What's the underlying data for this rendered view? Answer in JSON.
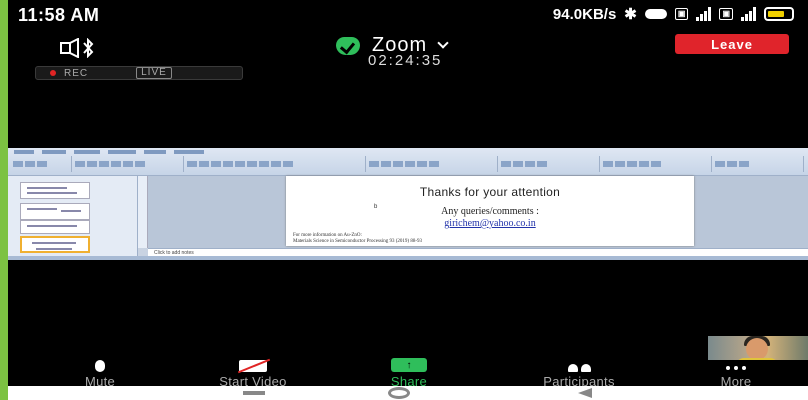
{
  "status_bar": {
    "time": "11:58 AM",
    "net_speed": "94.0KB/s"
  },
  "meeting": {
    "title": "Zoom",
    "timer": "02:24:35",
    "leave_label": "Leave",
    "rec_label": "REC",
    "live_label": "LIVE"
  },
  "slide": {
    "title": "Thanks for your attention",
    "bullet": "b",
    "queries": "Any queries/comments :",
    "email": "girichem@yahoo.co.in",
    "info_line1": "For more information on Au-ZnO:",
    "info_line2": "Materials Science in Semiconductor Processing 93 (2019) 88-93",
    "notes_placeholder": "Click to add notes"
  },
  "toolbar": {
    "mute": "Mute",
    "start_video": "Start Video",
    "share": "Share",
    "participants": "Participants",
    "more": "More"
  },
  "colors": {
    "frame": "#7cc242",
    "leave": "#e0242b",
    "share_accent": "#2fbe5b",
    "rec_dot": "#e02424"
  }
}
